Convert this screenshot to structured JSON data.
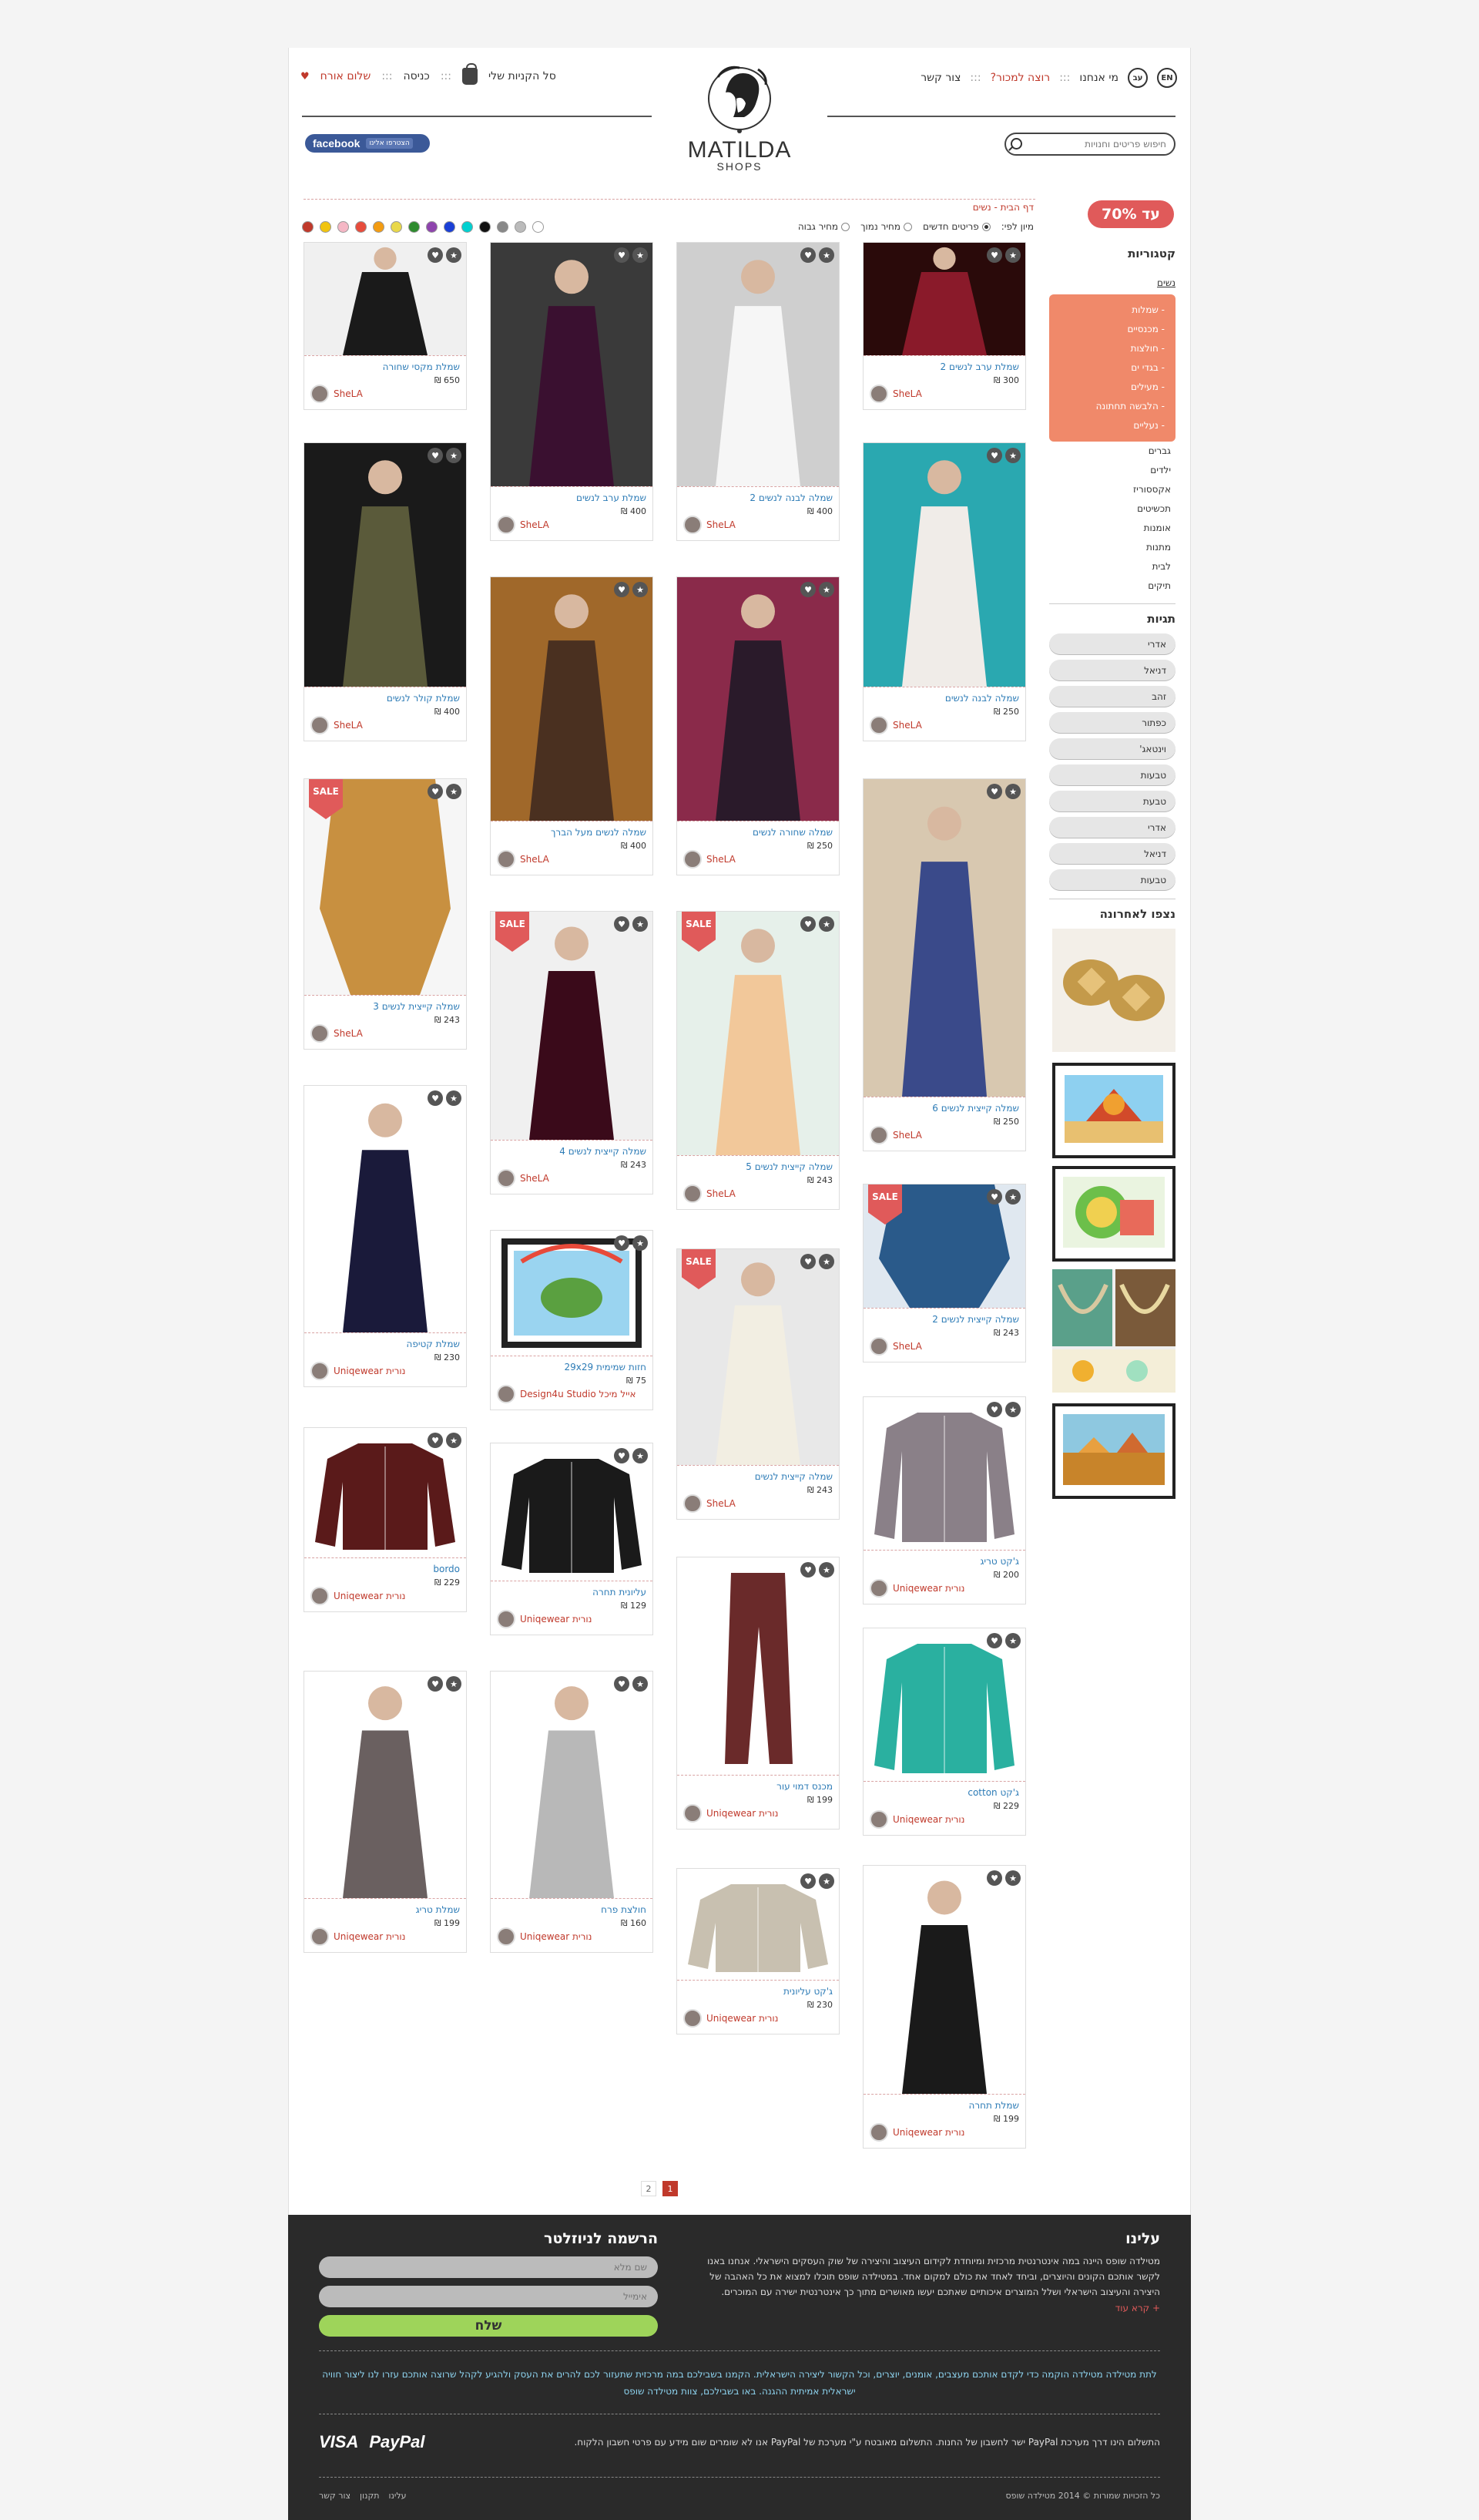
{
  "header": {
    "cart": "סל הקניות שלי",
    "login": "כניסה",
    "hello": "שלום אורח",
    "lang": "EN",
    "lang_he": "עב",
    "about": "מי אנחנו",
    "sell": "רוצה למכור?",
    "contact": "צור קשר",
    "logo_name": "MATILDA",
    "logo_sub": "SHOPS",
    "facebook": "facebook",
    "fb_join": "הצטרפו אלינו",
    "search_placeholder": "חיפוש פריטים וחנויות"
  },
  "promo": {
    "label": "עד 70%"
  },
  "breadcrumb": "דף הבית - נשים",
  "sort": {
    "label": "מיון לפי:",
    "opts": [
      "פריטים חדשים",
      "מחיר נמוך",
      "מחיר גבוה"
    ],
    "selected": 0
  },
  "colors": [
    "#c0392b",
    "#f1c40f",
    "#f5b7c5",
    "#e74c3c",
    "#f39c12",
    "#e9d84a",
    "#2e8b2e",
    "#8e44ad",
    "#1a3fd6",
    "#00d0d0",
    "#111111",
    "#888888",
    "#bbbbbb",
    "#ffffff"
  ],
  "sidebar": {
    "categories_title": "קטגוריות",
    "women": "נשים",
    "women_sub": [
      "- שמלות",
      "- מכנסיים",
      "- חולצות",
      "- בגדי ים",
      "- מעילים",
      "- הלבשה תחתונה",
      "- נעליים"
    ],
    "others": [
      "גברים",
      "ילדים",
      "אקססוריז",
      "תכשיטים",
      "אומנות",
      "מתנות",
      "לבית",
      "תיקים"
    ],
    "tags_title": "תגיות",
    "tags": [
      "אדרי",
      "דניאל",
      "זהב",
      "כפתור",
      "וינטאג'",
      "טבעות",
      "טבעת",
      "אדרי",
      "דניאל",
      "טבעות"
    ],
    "recent_title": "נצפו לאחרונה"
  },
  "products": [
    {
      "title": "שמלת ערב לנשים 2",
      "price": "300 ₪",
      "brand": "SheLA",
      "sale": false
    },
    {
      "title": "שמלה לבנה לנשים 2",
      "price": "400 ₪",
      "brand": "SheLA",
      "sale": false
    },
    {
      "title": "שמלת ערב לנשים",
      "price": "400 ₪",
      "brand": "SheLA",
      "sale": false
    },
    {
      "title": "שמלת מקסי שחורה",
      "price": "650 ₪",
      "brand": "SheLA",
      "sale": false
    },
    {
      "title": "שמלה לבנה לנשים",
      "price": "250 ₪",
      "brand": "SheLA",
      "sale": false
    },
    {
      "title": "שמלה שחורה לנשים",
      "price": "250 ₪",
      "brand": "SheLA",
      "sale": false
    },
    {
      "title": "שמלה לנשים מעל הברך",
      "price": "400 ₪",
      "brand": "SheLA",
      "sale": false
    },
    {
      "title": "שמלת קולר לנשים",
      "price": "400 ₪",
      "brand": "SheLA",
      "sale": false
    },
    {
      "title": "שמלה קייצית לנשים 6",
      "price": "250 ₪",
      "brand": "SheLA",
      "sale": false
    },
    {
      "title": "שמלה קייצית לנשים 5",
      "price": "243 ₪",
      "brand": "SheLA",
      "sale": true
    },
    {
      "title": "שמלה קייצית לנשים 4",
      "price": "243 ₪",
      "brand": "SheLA",
      "sale": true
    },
    {
      "title": "שמלה קייצית לנשים 3",
      "price": "243 ₪",
      "brand": "SheLA",
      "sale": true
    },
    {
      "title": "שמלה קייצית לנשים 2",
      "price": "243 ₪",
      "brand": "SheLA",
      "sale": true
    },
    {
      "title": "שמלה קייצית לנשים",
      "price": "243 ₪",
      "brand": "SheLA",
      "sale": true
    },
    {
      "title": "חזות שמימית 29x29",
      "price": "75 ₪",
      "brand": "Design4u Studio אייל מיכל",
      "sale": false
    },
    {
      "title": "שמלת קטיפה",
      "price": "230 ₪",
      "brand": "Uniqewear נורית",
      "sale": false
    },
    {
      "title": "ג'קט טריג",
      "price": "200 ₪",
      "brand": "Uniqewear נורית",
      "sale": false
    },
    {
      "title": "מכנס דמוי עור",
      "price": "199 ₪",
      "brand": "Uniqewear נורית",
      "sale": false
    },
    {
      "title": "עליונית תחרה",
      "price": "129 ₪",
      "brand": "Uniqewear נורית",
      "sale": false
    },
    {
      "title": "bordo",
      "price": "229 ₪",
      "brand": "Uniqewear נורית",
      "sale": false
    },
    {
      "title": "ג'קט cotton",
      "price": "229 ₪",
      "brand": "Uniqewear נורית",
      "sale": false
    },
    {
      "title": "ג'קט עליונית",
      "price": "230 ₪",
      "brand": "Uniqewear נורית",
      "sale": false
    },
    {
      "title": "חולצת פרח",
      "price": "160 ₪",
      "brand": "Uniqewear נורית",
      "sale": false
    },
    {
      "title": "שמלת טריג",
      "price": "199 ₪",
      "brand": "Uniqewear נורית",
      "sale": false
    },
    {
      "title": "שמלת תחרה",
      "price": "199 ₪",
      "brand": "Uniqewear נורית",
      "sale": false
    }
  ],
  "pager": {
    "pages": [
      "2",
      "1"
    ],
    "current": "1"
  },
  "footer": {
    "about_title": "עלינו",
    "about_text": "מטילדה שופס היינה במה אינטרנטית מרכזית ומיוחדת לקידום העיצוב והיצירה של שוק העסקים הישראלי. אנחנו באנו לקשר אותכם הקונים והיוצרים, וביחד לאחד את כולם למקום אחד. במטילדה שופס תוכלו למצוא את כל האהבה של היצירה והעיצוב הישראלי ושלל המוצרים איכותיים שאתכם יעשו מאושרים מתוך כך אינטרנטית ישירה עם המוכרים.",
    "read_more": "+ קרא עוד",
    "news_title": "הרשמה לניוזלטר",
    "name_ph": "שם מלא",
    "email_ph": "אימייל",
    "send": "שלח",
    "mission": "לתת מטילדה מטילדה הוקמה כדי לקדם אותכם מעצבים, אומנים, יוצרים, וכל הקשור ליצירה הישראלית. הקמנו בשבילכם במה מרכזית שתעזור לכם להרים את העסק ולהגיע לקהל שרוצה אותכם עזרו לנו ליצור חוויה ישראלית אמיתית ההגנה. באו בשבילכם, צוות מטילדה שופס",
    "pay_text": "התשלום הינו דרך מערכת PayPal ישר לחשבון של החנות. התשלום מאובטח ע\"י מערכת של PayPal אנו לא שומרים שום מידע עם פרטי חשבון הלקוח.",
    "visa": "VISA",
    "paypal": "PayPal",
    "copyright": "כל הזכויות שמורות © 2014 מטילדה שופס",
    "links": [
      "עלינו",
      "תקנון",
      "צור קשר"
    ]
  }
}
